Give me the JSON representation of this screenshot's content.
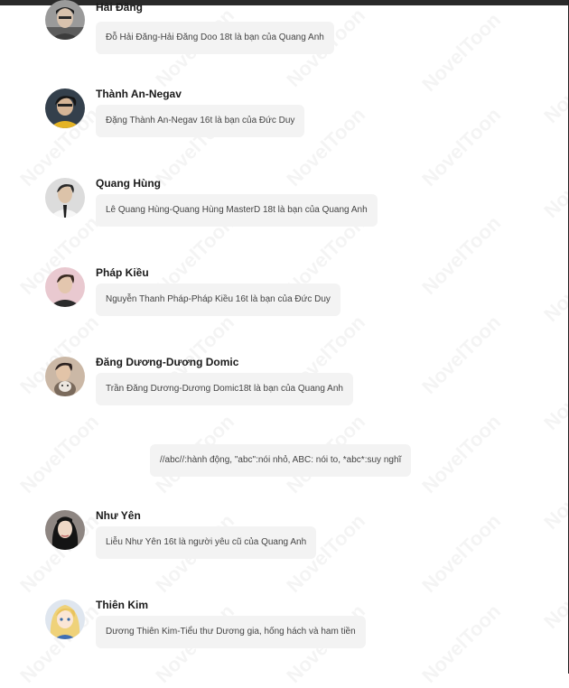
{
  "watermark_text": "NovelToon",
  "messages": [
    {
      "name": "Hải Đăng",
      "text": "Đỗ Hải Đăng-Hải Đăng Doo 18t là bạn của Quang Anh",
      "avatar": "portrait-dark-hair-glasses"
    },
    {
      "name": "Thành An-Negav",
      "text": "Đặng Thành An-Negav 16t là bạn của Đức Duy",
      "avatar": "portrait-yellow-shirt"
    },
    {
      "name": "Quang Hùng",
      "text": "Lê Quang Hùng-Quang Hùng MasterD 18t là bạn của Quang Anh",
      "avatar": "portrait-white-shirt-tie"
    },
    {
      "name": "Pháp Kiều",
      "text": "Nguyễn Thanh Pháp-Pháp Kiều 16t là bạn của Đức Duy",
      "avatar": "portrait-pink-background"
    },
    {
      "name": "Đăng Dương-Dương Domic",
      "text": "Trần Đăng Dương-Dương Domic18t là bạn của Quang Anh",
      "avatar": "portrait-holding-cat"
    },
    {
      "name": "Như Yên",
      "text": "Liễu Như Yên 16t là người yêu cũ của Quang Anh",
      "avatar": "portrait-long-dark-hair"
    },
    {
      "name": "Thiên Kim",
      "text": "Dương Thiên Kim-Tiểu thư Dương gia, hống hách và ham tiền",
      "avatar": "anime-blonde-girl"
    }
  ],
  "narration": {
    "text": "//abc//:hành động, \"abc\":nói nhỏ, ABC: nói to, *abc*:suy nghĩ"
  },
  "colors": {
    "bubble_bg": "#f3f3f3",
    "name_text": "#1a1a1a",
    "bubble_text": "#444444",
    "top_bar": "#2a2a2a"
  }
}
